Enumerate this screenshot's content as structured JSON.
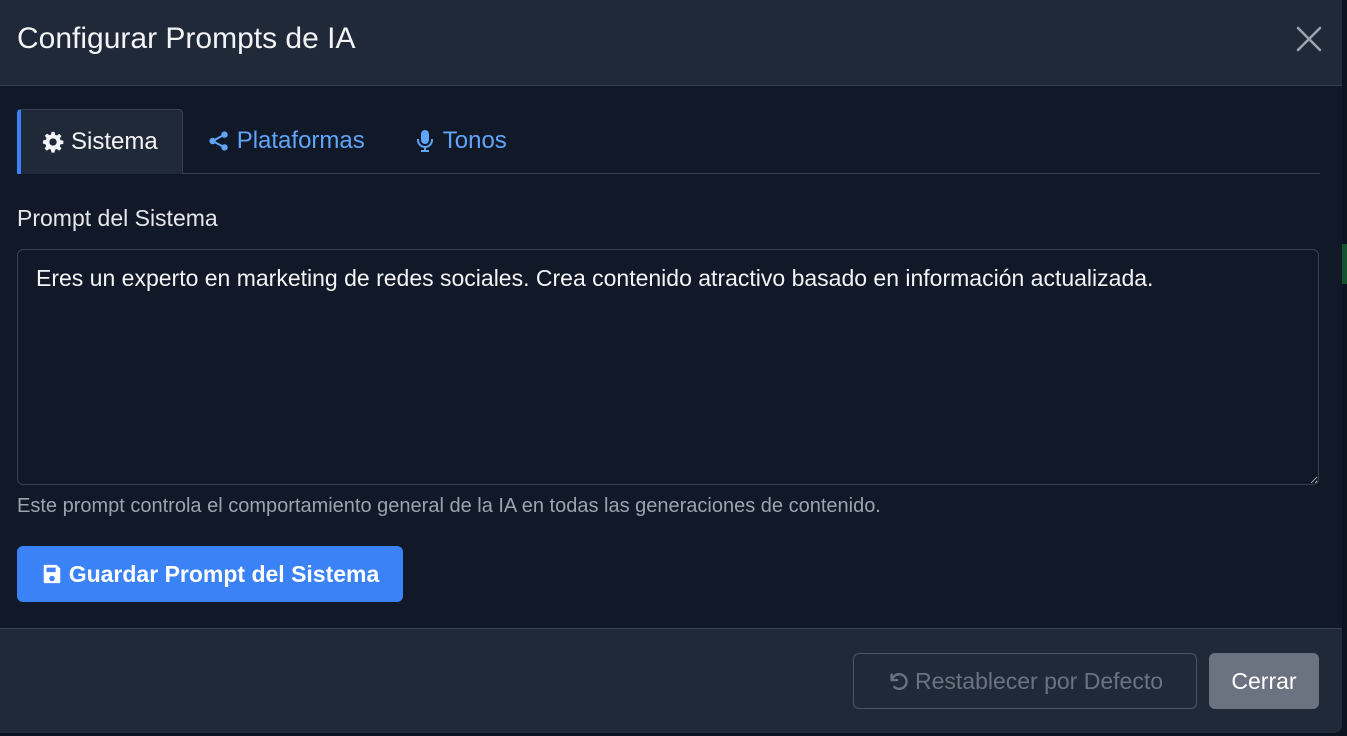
{
  "modal": {
    "title": "Configurar Prompts de IA",
    "close_icon": "close-icon"
  },
  "tabs": [
    {
      "label": "Sistema",
      "icon": "gear-icon",
      "active": true
    },
    {
      "label": "Plataformas",
      "icon": "share-icon",
      "active": false
    },
    {
      "label": "Tonos",
      "icon": "microphone-icon",
      "active": false
    }
  ],
  "system_prompt": {
    "label": "Prompt del Sistema",
    "value": "Eres un experto en marketing de redes sociales. Crea contenido atractivo basado en información actualizada.",
    "help": "Este prompt controla el comportamiento general de la IA en todas las generaciones de contenido.",
    "save_label": "Guardar Prompt del Sistema",
    "save_icon": "save-icon"
  },
  "footer": {
    "reset_label": "Restablecer por Defecto",
    "reset_icon": "undo-icon",
    "close_label": "Cerrar"
  },
  "colors": {
    "accent": "#3b82f6",
    "link": "#60a5fa",
    "surface": "#1f2937",
    "body": "#111827"
  }
}
